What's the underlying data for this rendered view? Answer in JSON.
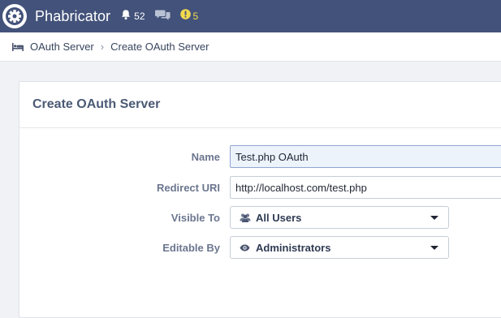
{
  "app": {
    "title": "Phabricator"
  },
  "topbar": {
    "notifications_count": "52",
    "warnings_count": "5",
    "icons": [
      "cog-logo-icon",
      "bell-icon",
      "chat-icon",
      "alert-icon"
    ],
    "colors": {
      "bar": "#43527a",
      "warning": "#f2d94e"
    }
  },
  "breadcrumb": {
    "items": [
      "OAuth Server",
      "Create OAuth Server"
    ],
    "icon": "bed-icon"
  },
  "panel": {
    "title": "Create OAuth Server",
    "fields": {
      "name": {
        "label": "Name",
        "value": "Test.php OAuth"
      },
      "redirect_uri": {
        "label": "Redirect URI",
        "value": "http://localhost.com/test.php"
      },
      "visible_to": {
        "label": "Visible To",
        "value": "All Users",
        "icon": "users-icon"
      },
      "editable_by": {
        "label": "Editable By",
        "value": "Administrators",
        "icon": "eye-icon"
      }
    }
  }
}
